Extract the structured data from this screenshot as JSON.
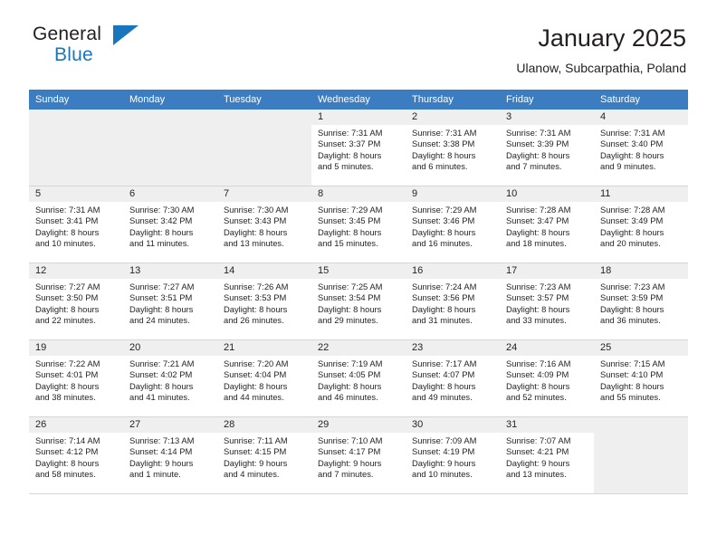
{
  "logo": {
    "word1": "General",
    "word2": "Blue",
    "triangle_color": "#1a76bc"
  },
  "header": {
    "title": "January 2025",
    "subtitle": "Ulanow, Subcarpathia, Poland"
  },
  "theme": {
    "header_row_bg": "#3b7dc0",
    "header_row_text": "#ffffff",
    "daynum_bar_bg": "#efefef",
    "empty_cell_bg": "#efefef",
    "grid_line": "#d5d5d5",
    "text": "#231f20"
  },
  "labels": {
    "sunrise_prefix": "Sunrise:",
    "sunset_prefix": "Sunset:",
    "daylight_prefix": "Daylight:"
  },
  "weekdays": [
    "Sunday",
    "Monday",
    "Tuesday",
    "Wednesday",
    "Thursday",
    "Friday",
    "Saturday"
  ],
  "weeks": [
    [
      {
        "day": "",
        "empty": true
      },
      {
        "day": "",
        "empty": true
      },
      {
        "day": "",
        "empty": true
      },
      {
        "day": "1",
        "sunrise": "Sunrise: 7:31 AM",
        "sunset": "Sunset: 3:37 PM",
        "daylight1": "Daylight: 8 hours",
        "daylight2": "and 5 minutes."
      },
      {
        "day": "2",
        "sunrise": "Sunrise: 7:31 AM",
        "sunset": "Sunset: 3:38 PM",
        "daylight1": "Daylight: 8 hours",
        "daylight2": "and 6 minutes."
      },
      {
        "day": "3",
        "sunrise": "Sunrise: 7:31 AM",
        "sunset": "Sunset: 3:39 PM",
        "daylight1": "Daylight: 8 hours",
        "daylight2": "and 7 minutes."
      },
      {
        "day": "4",
        "sunrise": "Sunrise: 7:31 AM",
        "sunset": "Sunset: 3:40 PM",
        "daylight1": "Daylight: 8 hours",
        "daylight2": "and 9 minutes."
      }
    ],
    [
      {
        "day": "5",
        "sunrise": "Sunrise: 7:31 AM",
        "sunset": "Sunset: 3:41 PM",
        "daylight1": "Daylight: 8 hours",
        "daylight2": "and 10 minutes."
      },
      {
        "day": "6",
        "sunrise": "Sunrise: 7:30 AM",
        "sunset": "Sunset: 3:42 PM",
        "daylight1": "Daylight: 8 hours",
        "daylight2": "and 11 minutes."
      },
      {
        "day": "7",
        "sunrise": "Sunrise: 7:30 AM",
        "sunset": "Sunset: 3:43 PM",
        "daylight1": "Daylight: 8 hours",
        "daylight2": "and 13 minutes."
      },
      {
        "day": "8",
        "sunrise": "Sunrise: 7:29 AM",
        "sunset": "Sunset: 3:45 PM",
        "daylight1": "Daylight: 8 hours",
        "daylight2": "and 15 minutes."
      },
      {
        "day": "9",
        "sunrise": "Sunrise: 7:29 AM",
        "sunset": "Sunset: 3:46 PM",
        "daylight1": "Daylight: 8 hours",
        "daylight2": "and 16 minutes."
      },
      {
        "day": "10",
        "sunrise": "Sunrise: 7:28 AM",
        "sunset": "Sunset: 3:47 PM",
        "daylight1": "Daylight: 8 hours",
        "daylight2": "and 18 minutes."
      },
      {
        "day": "11",
        "sunrise": "Sunrise: 7:28 AM",
        "sunset": "Sunset: 3:49 PM",
        "daylight1": "Daylight: 8 hours",
        "daylight2": "and 20 minutes."
      }
    ],
    [
      {
        "day": "12",
        "sunrise": "Sunrise: 7:27 AM",
        "sunset": "Sunset: 3:50 PM",
        "daylight1": "Daylight: 8 hours",
        "daylight2": "and 22 minutes."
      },
      {
        "day": "13",
        "sunrise": "Sunrise: 7:27 AM",
        "sunset": "Sunset: 3:51 PM",
        "daylight1": "Daylight: 8 hours",
        "daylight2": "and 24 minutes."
      },
      {
        "day": "14",
        "sunrise": "Sunrise: 7:26 AM",
        "sunset": "Sunset: 3:53 PM",
        "daylight1": "Daylight: 8 hours",
        "daylight2": "and 26 minutes."
      },
      {
        "day": "15",
        "sunrise": "Sunrise: 7:25 AM",
        "sunset": "Sunset: 3:54 PM",
        "daylight1": "Daylight: 8 hours",
        "daylight2": "and 29 minutes."
      },
      {
        "day": "16",
        "sunrise": "Sunrise: 7:24 AM",
        "sunset": "Sunset: 3:56 PM",
        "daylight1": "Daylight: 8 hours",
        "daylight2": "and 31 minutes."
      },
      {
        "day": "17",
        "sunrise": "Sunrise: 7:23 AM",
        "sunset": "Sunset: 3:57 PM",
        "daylight1": "Daylight: 8 hours",
        "daylight2": "and 33 minutes."
      },
      {
        "day": "18",
        "sunrise": "Sunrise: 7:23 AM",
        "sunset": "Sunset: 3:59 PM",
        "daylight1": "Daylight: 8 hours",
        "daylight2": "and 36 minutes."
      }
    ],
    [
      {
        "day": "19",
        "sunrise": "Sunrise: 7:22 AM",
        "sunset": "Sunset: 4:01 PM",
        "daylight1": "Daylight: 8 hours",
        "daylight2": "and 38 minutes."
      },
      {
        "day": "20",
        "sunrise": "Sunrise: 7:21 AM",
        "sunset": "Sunset: 4:02 PM",
        "daylight1": "Daylight: 8 hours",
        "daylight2": "and 41 minutes."
      },
      {
        "day": "21",
        "sunrise": "Sunrise: 7:20 AM",
        "sunset": "Sunset: 4:04 PM",
        "daylight1": "Daylight: 8 hours",
        "daylight2": "and 44 minutes."
      },
      {
        "day": "22",
        "sunrise": "Sunrise: 7:19 AM",
        "sunset": "Sunset: 4:05 PM",
        "daylight1": "Daylight: 8 hours",
        "daylight2": "and 46 minutes."
      },
      {
        "day": "23",
        "sunrise": "Sunrise: 7:17 AM",
        "sunset": "Sunset: 4:07 PM",
        "daylight1": "Daylight: 8 hours",
        "daylight2": "and 49 minutes."
      },
      {
        "day": "24",
        "sunrise": "Sunrise: 7:16 AM",
        "sunset": "Sunset: 4:09 PM",
        "daylight1": "Daylight: 8 hours",
        "daylight2": "and 52 minutes."
      },
      {
        "day": "25",
        "sunrise": "Sunrise: 7:15 AM",
        "sunset": "Sunset: 4:10 PM",
        "daylight1": "Daylight: 8 hours",
        "daylight2": "and 55 minutes."
      }
    ],
    [
      {
        "day": "26",
        "sunrise": "Sunrise: 7:14 AM",
        "sunset": "Sunset: 4:12 PM",
        "daylight1": "Daylight: 8 hours",
        "daylight2": "and 58 minutes."
      },
      {
        "day": "27",
        "sunrise": "Sunrise: 7:13 AM",
        "sunset": "Sunset: 4:14 PM",
        "daylight1": "Daylight: 9 hours",
        "daylight2": "and 1 minute."
      },
      {
        "day": "28",
        "sunrise": "Sunrise: 7:11 AM",
        "sunset": "Sunset: 4:15 PM",
        "daylight1": "Daylight: 9 hours",
        "daylight2": "and 4 minutes."
      },
      {
        "day": "29",
        "sunrise": "Sunrise: 7:10 AM",
        "sunset": "Sunset: 4:17 PM",
        "daylight1": "Daylight: 9 hours",
        "daylight2": "and 7 minutes."
      },
      {
        "day": "30",
        "sunrise": "Sunrise: 7:09 AM",
        "sunset": "Sunset: 4:19 PM",
        "daylight1": "Daylight: 9 hours",
        "daylight2": "and 10 minutes."
      },
      {
        "day": "31",
        "sunrise": "Sunrise: 7:07 AM",
        "sunset": "Sunset: 4:21 PM",
        "daylight1": "Daylight: 9 hours",
        "daylight2": "and 13 minutes."
      },
      {
        "day": "",
        "empty": true
      }
    ]
  ]
}
